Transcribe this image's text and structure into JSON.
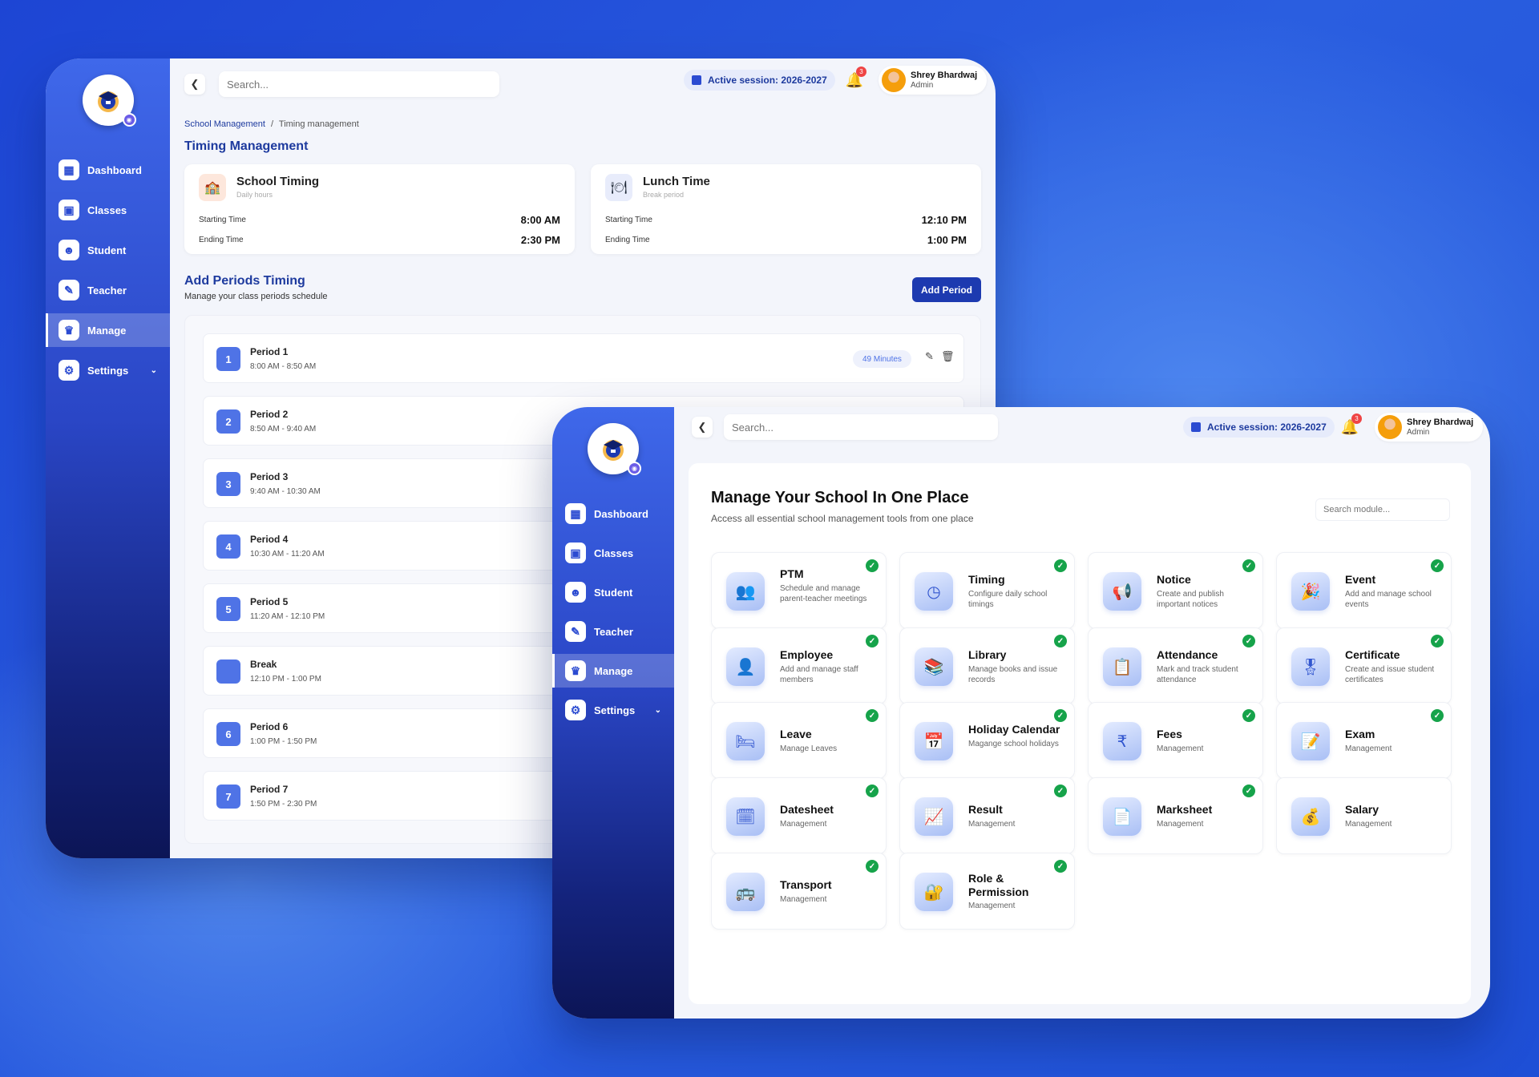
{
  "sidebar": {
    "items": [
      {
        "label": "Dashboard",
        "icon": "dashboard-icon"
      },
      {
        "label": "Classes",
        "icon": "classes-icon"
      },
      {
        "label": "Student",
        "icon": "student-icon"
      },
      {
        "label": "Teacher",
        "icon": "teacher-icon"
      },
      {
        "label": "Manage",
        "icon": "manage-icon"
      },
      {
        "label": "Settings",
        "icon": "settings-icon"
      }
    ],
    "active": "Manage"
  },
  "header": {
    "search_placeholder": "Search...",
    "session": "Active session: 2026-2027",
    "notifications": "3",
    "user_name": "Shrey Bhardwaj",
    "user_role": "Admin"
  },
  "timing": {
    "breadcrumb_root": "School Management",
    "breadcrumb_sep": "/",
    "breadcrumb_current": "Timing management",
    "title": "Timing Management",
    "school": {
      "title": "School Timing",
      "subtitle": "Daily hours",
      "start_label": "Starting Time",
      "start": "8:00 AM",
      "end_label": "Ending Time",
      "end": "2:30 PM"
    },
    "lunch": {
      "title": "Lunch Time",
      "subtitle": "Break period",
      "start_label": "Starting Time",
      "start": "12:10 PM",
      "end_label": "Ending Time",
      "end": "1:00 PM"
    },
    "periods_title": "Add Periods Timing",
    "periods_subtitle": "Manage your class periods schedule",
    "add_button": "Add Period",
    "periods": [
      {
        "num": "1",
        "name": "Period 1",
        "time": "8:00 AM - 8:50 AM",
        "duration": "49 Minutes"
      },
      {
        "num": "2",
        "name": "Period 2",
        "time": "8:50 AM - 9:40 AM"
      },
      {
        "num": "3",
        "name": "Period 3",
        "time": "9:40 AM - 10:30 AM"
      },
      {
        "num": "4",
        "name": "Period 4",
        "time": "10:30 AM - 11:20 AM"
      },
      {
        "num": "5",
        "name": "Period 5",
        "time": "11:20 AM - 12:10 PM"
      },
      {
        "num": "",
        "name": "Break",
        "time": "12:10 PM - 1:00 PM"
      },
      {
        "num": "6",
        "name": "Period 6",
        "time": "1:00 PM - 1:50 PM"
      },
      {
        "num": "7",
        "name": "Period 7",
        "time": "1:50 PM - 2:30 PM"
      }
    ]
  },
  "manage": {
    "title": "Manage Your School In One Place",
    "subtitle": "Access all essential school management tools from one place",
    "search_placeholder": "Search module...",
    "modules": [
      {
        "title": "PTM",
        "desc": "Schedule and manage parent-teacher meetings",
        "icon": "ptm-icon",
        "checked": true
      },
      {
        "title": "Timing",
        "desc": "Configure daily school timings",
        "icon": "clock-icon",
        "checked": true
      },
      {
        "title": "Notice",
        "desc": "Create and publish important notices",
        "icon": "megaphone-icon",
        "checked": true
      },
      {
        "title": "Event",
        "desc": "Add and manage school events",
        "icon": "event-icon",
        "checked": true
      },
      {
        "title": "Employee",
        "desc": "Add and manage staff members",
        "icon": "employee-icon",
        "checked": true
      },
      {
        "title": "Library",
        "desc": "Manage books and issue records",
        "icon": "library-icon",
        "checked": true
      },
      {
        "title": "Attendance",
        "desc": "Mark and track student attendance",
        "icon": "attendance-icon",
        "checked": true
      },
      {
        "title": "Certificate",
        "desc": "Create and issue student certificates",
        "icon": "certificate-icon",
        "checked": true
      },
      {
        "title": "Leave",
        "desc": "Manage Leaves",
        "icon": "leave-icon",
        "checked": true
      },
      {
        "title": "Holiday Calendar",
        "desc": "Magange school holidays",
        "icon": "calendar-icon",
        "checked": true
      },
      {
        "title": "Fees",
        "desc": "Management",
        "icon": "fees-icon",
        "checked": true
      },
      {
        "title": "Exam",
        "desc": "Management",
        "icon": "exam-icon",
        "checked": true
      },
      {
        "title": "Datesheet",
        "desc": "Management",
        "icon": "datesheet-icon",
        "checked": true
      },
      {
        "title": "Result",
        "desc": "Management",
        "icon": "result-icon",
        "checked": true
      },
      {
        "title": "Marksheet",
        "desc": "Management",
        "icon": "marksheet-icon",
        "checked": true
      },
      {
        "title": "Salary",
        "desc": "Management",
        "icon": "salary-icon",
        "checked": false
      },
      {
        "title": "Transport",
        "desc": "Management",
        "icon": "transport-icon",
        "checked": true
      },
      {
        "title": "Role & Permission",
        "desc": "Management",
        "icon": "role-permission-icon",
        "checked": true
      }
    ]
  }
}
